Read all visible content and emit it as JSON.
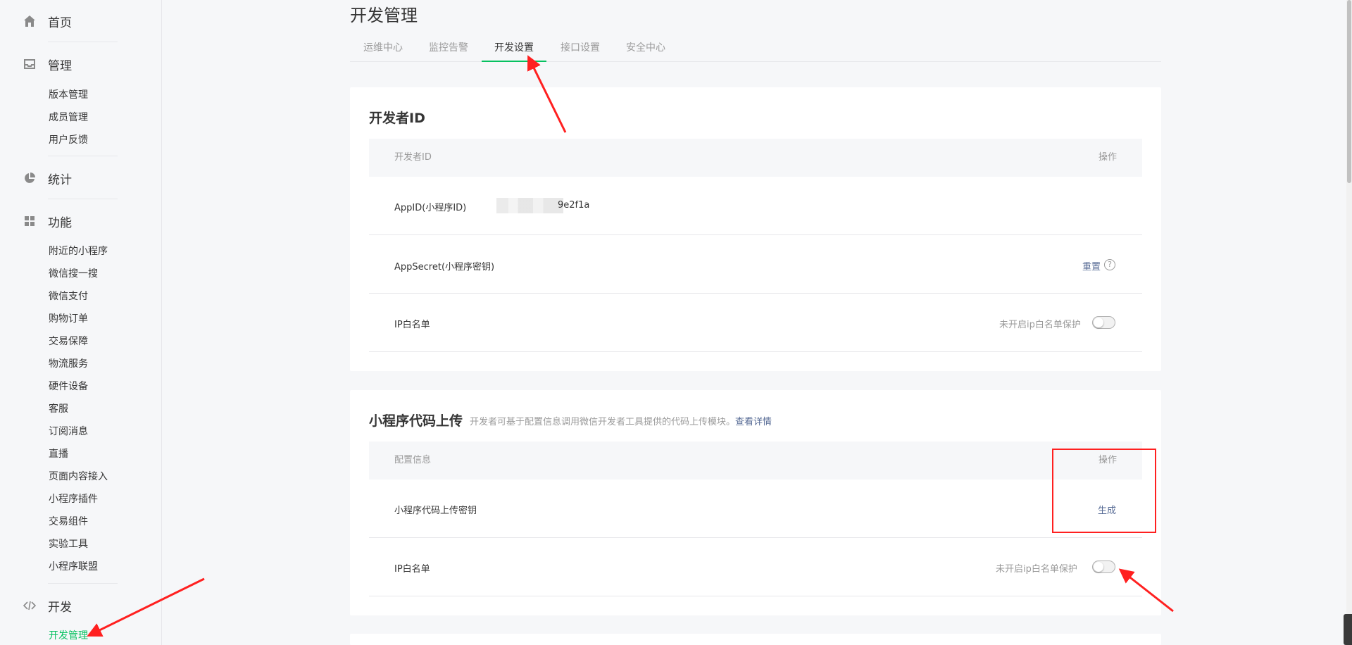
{
  "sidebar": {
    "home": {
      "label": "首页",
      "icon": "home-icon"
    },
    "manage": {
      "label": "管理",
      "icon": "inbox-icon",
      "items": [
        "版本管理",
        "成员管理",
        "用户反馈"
      ]
    },
    "stats": {
      "label": "统计",
      "icon": "pie-chart-icon"
    },
    "features": {
      "label": "功能",
      "icon": "grid-icon",
      "items": [
        "附近的小程序",
        "微信搜一搜",
        "微信支付",
        "购物订单",
        "交易保障",
        "物流服务",
        "硬件设备",
        "客服",
        "订阅消息",
        "直播",
        "页面内容接入",
        "小程序插件",
        "交易组件",
        "实验工具",
        "小程序联盟"
      ]
    },
    "dev": {
      "label": "开发",
      "icon": "code-icon",
      "items": [
        "开发管理"
      ],
      "active_item": "开发管理"
    }
  },
  "page": {
    "title": "开发管理",
    "tabs": [
      "运维中心",
      "监控告警",
      "开发设置",
      "接口设置",
      "安全中心"
    ],
    "active_tab": "开发设置"
  },
  "developer_id_card": {
    "title": "开发者ID",
    "header": {
      "col1": "开发者ID",
      "col2": "操作"
    },
    "rows": {
      "appid": {
        "label": "AppID(小程序ID)",
        "value_visible": "9e2f1a"
      },
      "appsecret": {
        "label": "AppSecret(小程序密钥)",
        "action": "重置",
        "help": "?"
      },
      "ip_whitelist": {
        "label": "IP白名单",
        "status": "未开启ip白名单保护",
        "toggle_on": false
      }
    }
  },
  "upload_card": {
    "title": "小程序代码上传",
    "desc": "开发者可基于配置信息调用微信开发者工具提供的代码上传模块。",
    "desc_link": "查看详情",
    "header": {
      "col1": "配置信息",
      "col2": "操作"
    },
    "rows": {
      "upload_key": {
        "label": "小程序代码上传密钥",
        "action": "生成"
      },
      "ip_whitelist": {
        "label": "IP白名单",
        "status": "未开启ip白名单保护",
        "toggle_on": false
      }
    }
  },
  "colors": {
    "accent_green": "#07c160",
    "link_blue": "#576b95",
    "annotation_red": "#ff2020"
  }
}
